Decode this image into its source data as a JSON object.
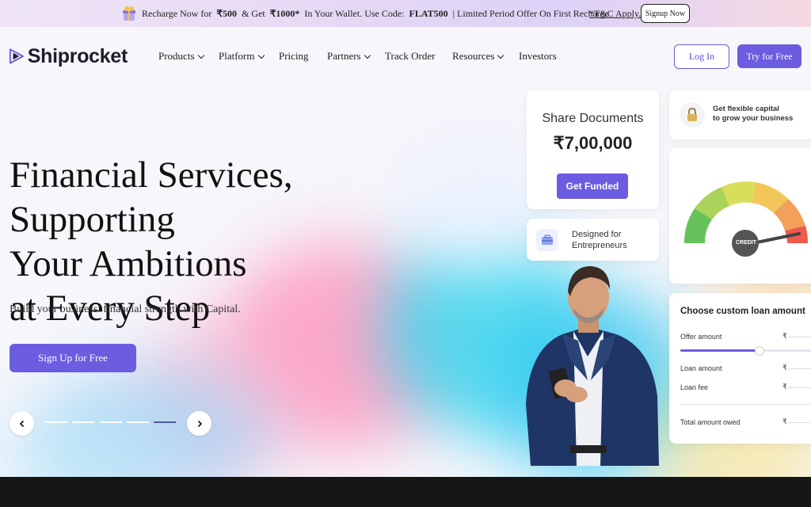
{
  "promo": {
    "text_pre": "Recharge Now for",
    "amount1": "₹500",
    "text_mid": "& Get",
    "amount2": "₹1000*",
    "text_code_label": "In Your Wallet. Use Code:",
    "code": "FLAT500",
    "text_post": "| Limited Period Offer On First Recharge",
    "tc": "*T&C Apply.",
    "signup": "Signup Now"
  },
  "brand": {
    "name": "Shiprocket",
    "color": "#6c5ce0"
  },
  "nav": {
    "items": [
      {
        "label": "Products",
        "dropdown": true
      },
      {
        "label": "Platform",
        "dropdown": true
      },
      {
        "label": "Pricing",
        "dropdown": false
      },
      {
        "label": "Partners",
        "dropdown": true
      },
      {
        "label": "Track Order",
        "dropdown": false
      },
      {
        "label": "Resources",
        "dropdown": true
      },
      {
        "label": "Investors",
        "dropdown": false
      }
    ],
    "login": "Log In",
    "try": "Try for Free"
  },
  "hero": {
    "headline_line1": "Financial Services, Supporting",
    "headline_line2": "Your Ambitions",
    "headline_line3": "at Every Step",
    "subtext": "Build your business’ financial strength with Capital.",
    "cta": "Sign Up for Free",
    "carousel": {
      "slides": 5,
      "active_index": 4
    }
  },
  "cards": {
    "share": {
      "title": "Share Documents",
      "amount": "₹7,00,000",
      "button": "Get Funded"
    },
    "designed": {
      "text_line1": "Designed for",
      "text_line2": "Entrepreneurs"
    },
    "capital": {
      "text_line1": "Get flexible capital",
      "text_line2": "to grow your business"
    },
    "gauge": {
      "label": "CREDIT"
    },
    "loan": {
      "title": "Choose custom loan amount",
      "offer": "Offer amount",
      "offer_level": 0.6,
      "loan_amount": "Loan amount",
      "loan_fee": "Loan fee",
      "total": "Total amount owed",
      "currency": "₹"
    }
  }
}
